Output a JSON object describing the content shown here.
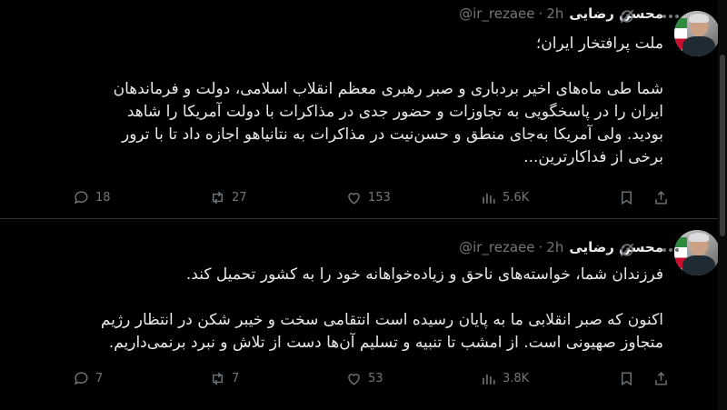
{
  "tweets": [
    {
      "name": "محسن رضایی",
      "handle": "@ir_rezaee",
      "separator": "·",
      "time": "2h",
      "paragraphs": [
        "ملت پرافتخار ایران؛",
        "شما طی ماه‌های اخیر بردباری و صبر رهبری معظم انقلاب اسلامی، دولت و فرماندهان ایران را در پاسخگویی به تجاوزات و حضور جدی در مذاکرات با دولت آمریکا را شاهد بودید. ولی آمریکا به‌جای منطق و حسن‌نیت در مذاکرات به نتانیاهو اجازه داد تا با ترور برخی از فداکارترین..."
      ],
      "replies": "18",
      "reposts": "27",
      "likes": "153",
      "views": "5.6K"
    },
    {
      "name": "محسن رضایی",
      "handle": "@ir_rezaee",
      "separator": "·",
      "time": "2h",
      "paragraphs": [
        "فرزندان شما، خواسته‌های ناحق و زیاده‌خواهانه خود را به کشور تحمیل کند.",
        "اکنون که صبر انقلابی ما به پایان رسیده است انتقامی سخت و خیبر شکن در انتظار رژیم متجاوز صهیونی است. از امشب تا تنبیه و تسلیم آن‌ها دست از تلاش و نبرد برنمی‌داریم."
      ],
      "replies": "7",
      "reposts": "7",
      "likes": "53",
      "views": "3.8K"
    }
  ],
  "colors": {
    "background": "#000000",
    "text": "#e7e9ea",
    "muted": "#71767b",
    "divider": "#2f3336"
  }
}
